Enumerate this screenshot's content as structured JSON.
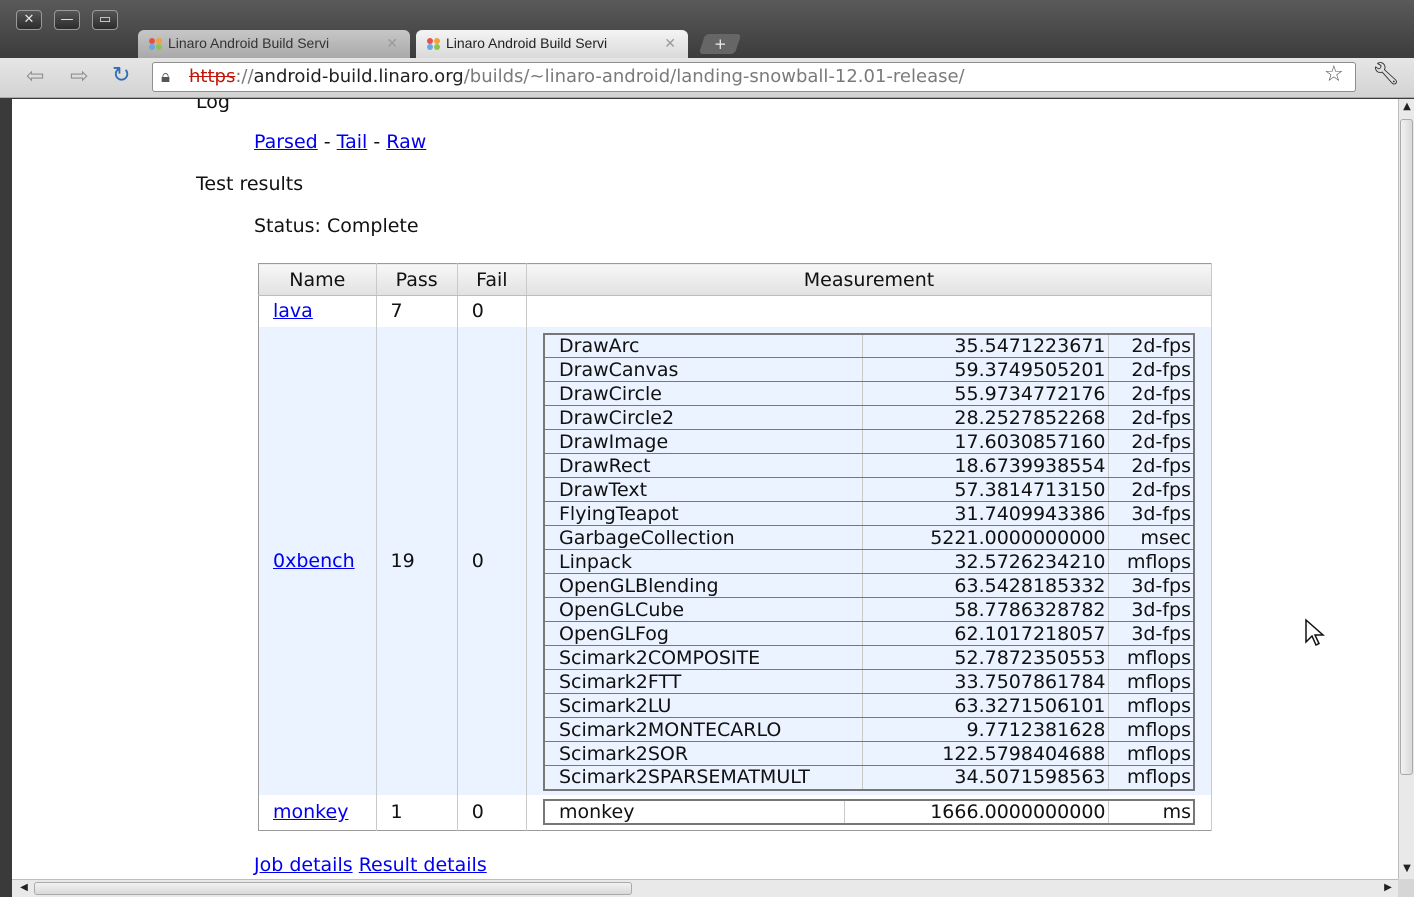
{
  "tabs": [
    {
      "title": "Linaro Android Build Servi",
      "active": false
    },
    {
      "title": "Linaro Android Build Servi",
      "active": true
    }
  ],
  "address": {
    "scheme": "https",
    "rest1": "://",
    "host": "android-build.linaro.org",
    "path": "/builds/~linaro-android/landing-snowball-12.01-release/"
  },
  "page": {
    "log_heading": "Log",
    "log_links": {
      "parsed": "Parsed",
      "tail": "Tail",
      "raw": "Raw",
      "separator": "-"
    },
    "test_results_heading": "Test results",
    "status": "Status: Complete",
    "columns": [
      "Name",
      "Pass",
      "Fail",
      "Measurement"
    ],
    "rows": [
      {
        "name": "lava",
        "pass": "7",
        "fail": "0"
      },
      {
        "name": "0xbench",
        "pass": "19",
        "fail": "0"
      },
      {
        "name": "monkey",
        "pass": "1",
        "fail": "0"
      }
    ],
    "oxbench_measurements": [
      {
        "test": "DrawArc",
        "value": "35.5471223671",
        "unit": "2d-fps"
      },
      {
        "test": "DrawCanvas",
        "value": "59.3749505201",
        "unit": "2d-fps"
      },
      {
        "test": "DrawCircle",
        "value": "55.9734772176",
        "unit": "2d-fps"
      },
      {
        "test": "DrawCircle2",
        "value": "28.2527852268",
        "unit": "2d-fps"
      },
      {
        "test": "DrawImage",
        "value": "17.6030857160",
        "unit": "2d-fps"
      },
      {
        "test": "DrawRect",
        "value": "18.6739938554",
        "unit": "2d-fps"
      },
      {
        "test": "DrawText",
        "value": "57.3814713150",
        "unit": "2d-fps"
      },
      {
        "test": "FlyingTeapot",
        "value": "31.7409943386",
        "unit": "3d-fps"
      },
      {
        "test": "GarbageCollection",
        "value": "5221.0000000000",
        "unit": "msec"
      },
      {
        "test": "Linpack",
        "value": "32.5726234210",
        "unit": "mflops"
      },
      {
        "test": "OpenGLBlending",
        "value": "63.5428185332",
        "unit": "3d-fps"
      },
      {
        "test": "OpenGLCube",
        "value": "58.7786328782",
        "unit": "3d-fps"
      },
      {
        "test": "OpenGLFog",
        "value": "62.1017218057",
        "unit": "3d-fps"
      },
      {
        "test": "Scimark2COMPOSITE",
        "value": "52.7872350553",
        "unit": "mflops"
      },
      {
        "test": "Scimark2FTT",
        "value": "33.7507861784",
        "unit": "mflops"
      },
      {
        "test": "Scimark2LU",
        "value": "63.3271506101",
        "unit": "mflops"
      },
      {
        "test": "Scimark2MONTECARLO",
        "value": "9.7712381628",
        "unit": "mflops"
      },
      {
        "test": "Scimark2SOR",
        "value": "122.5798404688",
        "unit": "mflops"
      },
      {
        "test": "Scimark2SPARSEMATMULT",
        "value": "34.5071598563",
        "unit": "mflops"
      }
    ],
    "monkey_measurement": {
      "test": "monkey",
      "value": "1666.0000000000",
      "unit": "ms"
    },
    "footer_links": {
      "job": "Job details",
      "result": "Result details"
    }
  },
  "icons": {
    "close": "close-icon",
    "minimize": "minimize-icon",
    "maximize": "maximize-icon",
    "back": "back-arrow-icon",
    "forward": "forward-arrow-icon",
    "reload": "reload-icon",
    "bookmark": "star-icon",
    "menu": "wrench-icon"
  }
}
